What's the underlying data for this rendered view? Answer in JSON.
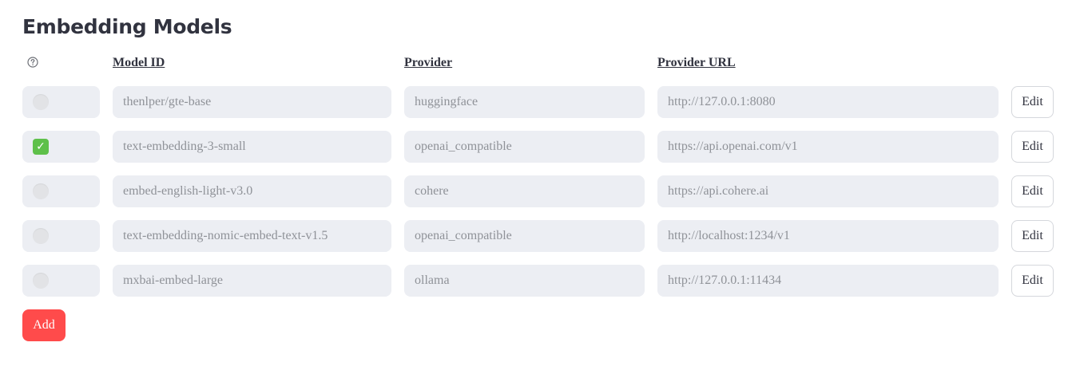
{
  "page": {
    "title": "Embedding Models"
  },
  "table": {
    "help_icon": "question-circle-icon",
    "headers": {
      "model_id": "Model ID",
      "provider": "Provider",
      "provider_url": "Provider URL"
    },
    "rows": [
      {
        "selected": false,
        "model_id": "thenlper/gte-base",
        "provider": "huggingface",
        "provider_url": "http://127.0.0.1:8080",
        "edit_label": "Edit"
      },
      {
        "selected": true,
        "model_id": "text-embedding-3-small",
        "provider": "openai_compatible",
        "provider_url": "https://api.openai.com/v1",
        "edit_label": "Edit"
      },
      {
        "selected": false,
        "model_id": "embed-english-light-v3.0",
        "provider": "cohere",
        "provider_url": "https://api.cohere.ai",
        "edit_label": "Edit"
      },
      {
        "selected": false,
        "model_id": "text-embedding-nomic-embed-text-v1.5",
        "provider": "openai_compatible",
        "provider_url": "http://localhost:1234/v1",
        "edit_label": "Edit"
      },
      {
        "selected": false,
        "model_id": "mxbai-embed-large",
        "provider": "ollama",
        "provider_url": "http://127.0.0.1:11434",
        "edit_label": "Edit"
      }
    ]
  },
  "actions": {
    "add_label": "Add"
  },
  "colors": {
    "accent": "#ff4b4b",
    "selected_check": "#5ec04a",
    "field_background": "#eceef3",
    "field_text": "#8f9298",
    "text": "#31333f"
  }
}
